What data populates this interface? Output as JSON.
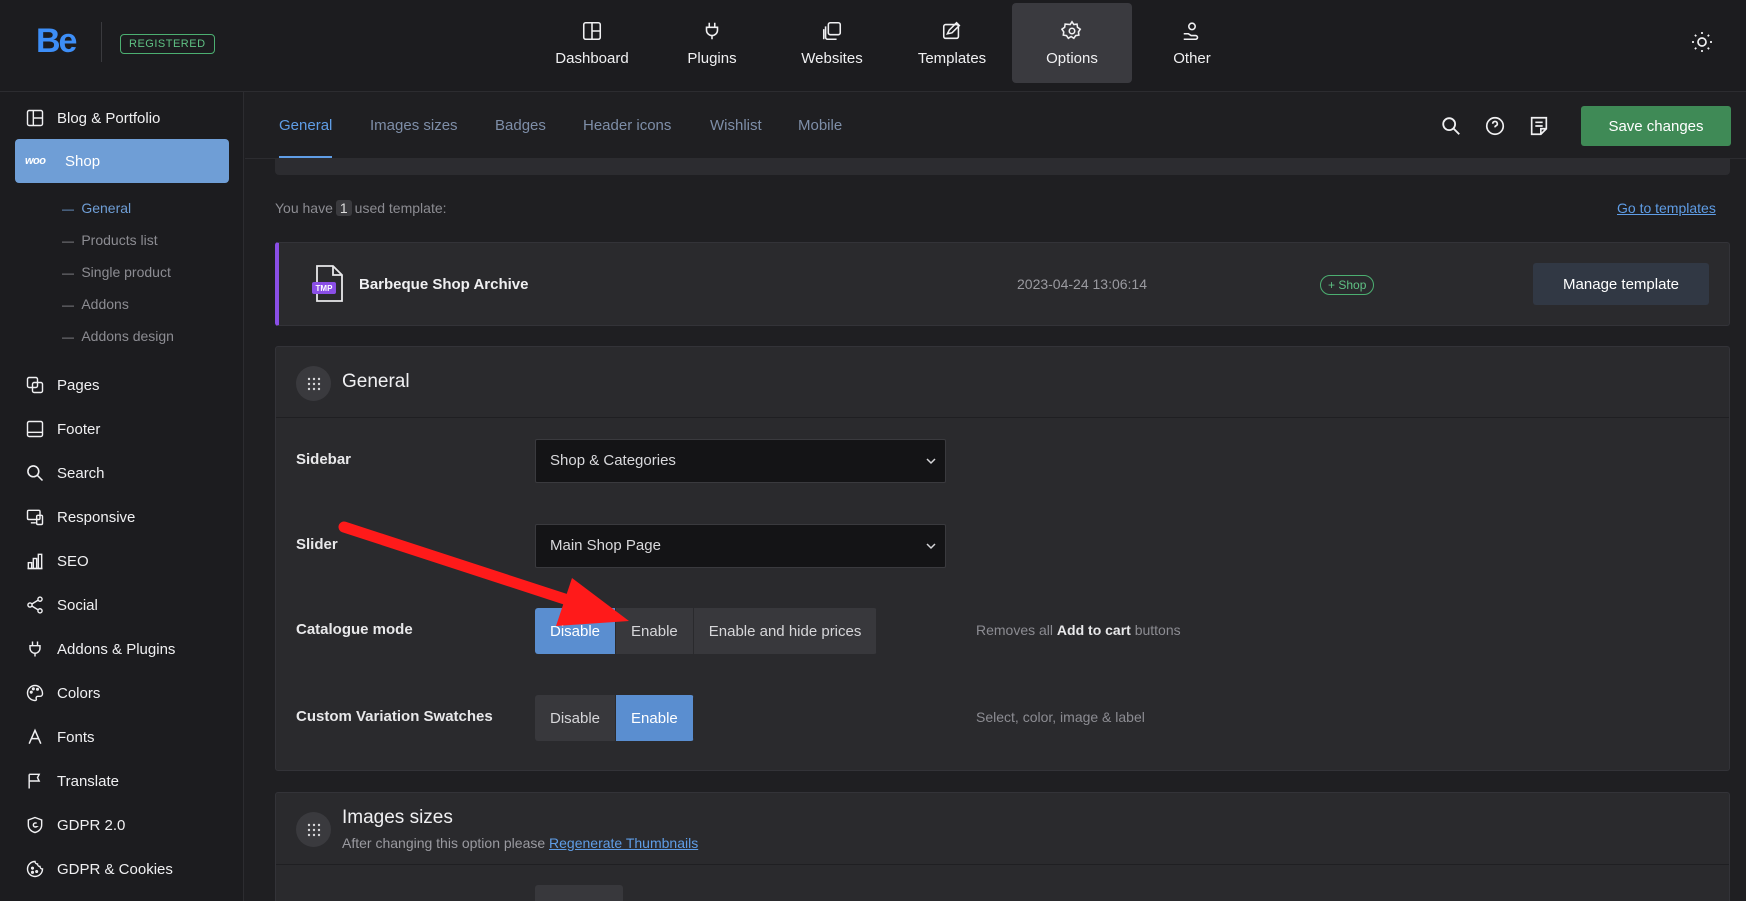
{
  "topbar": {
    "logo": "Be",
    "registered_badge": "REGISTERED",
    "nav": [
      {
        "label": "Dashboard",
        "icon": "dashboard-icon"
      },
      {
        "label": "Plugins",
        "icon": "plug-icon"
      },
      {
        "label": "Websites",
        "icon": "websites-icon"
      },
      {
        "label": "Templates",
        "icon": "templates-icon"
      },
      {
        "label": "Options",
        "icon": "gear-icon",
        "active": true
      },
      {
        "label": "Other",
        "icon": "hand-heart-icon"
      }
    ]
  },
  "sidebar": {
    "items": [
      {
        "label": "Blog & Portfolio",
        "icon": "layout-icon"
      },
      {
        "label": "Shop",
        "icon": "woo-icon",
        "icon_text": "woo",
        "active": true
      },
      {
        "label": "Pages",
        "icon": "pages-icon"
      },
      {
        "label": "Footer",
        "icon": "footer-icon"
      },
      {
        "label": "Search",
        "icon": "search-icon"
      },
      {
        "label": "Responsive",
        "icon": "responsive-icon"
      },
      {
        "label": "SEO",
        "icon": "seo-icon"
      },
      {
        "label": "Social",
        "icon": "share-icon"
      },
      {
        "label": "Addons & Plugins",
        "icon": "plug-icon"
      },
      {
        "label": "Colors",
        "icon": "palette-icon"
      },
      {
        "label": "Fonts",
        "icon": "font-icon"
      },
      {
        "label": "Translate",
        "icon": "flag-icon"
      },
      {
        "label": "GDPR 2.0",
        "icon": "shield-icon"
      },
      {
        "label": "GDPR & Cookies",
        "icon": "cookie-icon"
      }
    ],
    "shop_subitems": [
      {
        "label": "General",
        "active": true
      },
      {
        "label": "Products list"
      },
      {
        "label": "Single product"
      },
      {
        "label": "Addons"
      },
      {
        "label": "Addons design"
      }
    ]
  },
  "tabs": [
    {
      "label": "General",
      "active": true
    },
    {
      "label": "Images sizes"
    },
    {
      "label": "Badges"
    },
    {
      "label": "Header icons"
    },
    {
      "label": "Wishlist"
    },
    {
      "label": "Mobile"
    }
  ],
  "toolbar": {
    "save_label": "Save changes"
  },
  "templates": {
    "used_prefix": "You have",
    "used_count": "1",
    "used_suffix": "used template:",
    "go_link": "Go to templates",
    "item": {
      "icon_text": "TMP",
      "name": "Barbeque Shop Archive",
      "date": "2023-04-24 13:06:14",
      "badge": "+ Shop",
      "manage_label": "Manage template"
    }
  },
  "general_panel": {
    "title": "General",
    "sidebar_label": "Sidebar",
    "sidebar_value": "Shop & Categories",
    "slider_label": "Slider",
    "slider_value": "Main Shop Page",
    "catalogue_label": "Catalogue mode",
    "catalogue_options": [
      "Disable",
      "Enable",
      "Enable and hide prices"
    ],
    "catalogue_selected": "Disable",
    "catalogue_hint_prefix": "Removes all",
    "catalogue_hint_bold": "Add to cart",
    "catalogue_hint_suffix": "buttons",
    "swatches_label": "Custom Variation Swatches",
    "swatches_options": [
      "Disable",
      "Enable"
    ],
    "swatches_selected": "Enable",
    "swatches_hint": "Select, color, image & label"
  },
  "images_panel": {
    "title": "Images sizes",
    "subtitle_prefix": "After changing this option please",
    "subtitle_link": "Regenerate Thumbnails"
  },
  "colors": {
    "accent": "#5f9de6",
    "save": "#3f8a56",
    "template_border": "#8a4ee6",
    "annotation_arrow": "#ff1a1a"
  }
}
